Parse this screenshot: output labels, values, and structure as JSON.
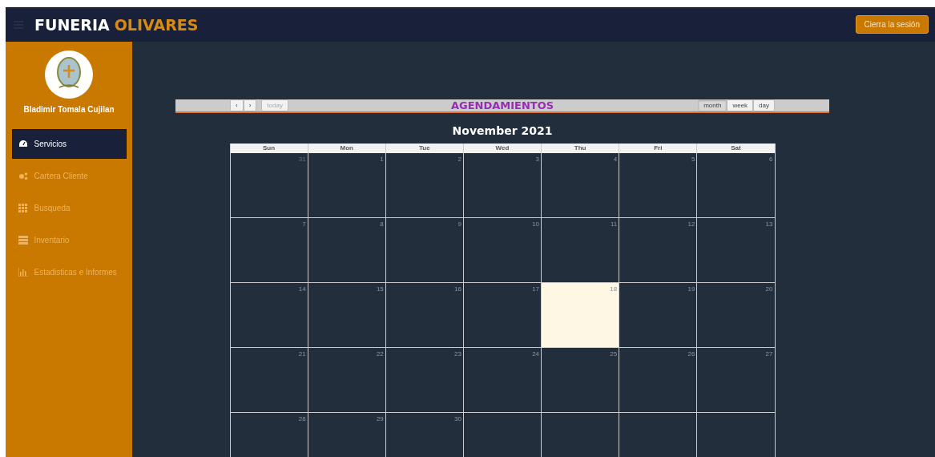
{
  "header": {
    "brand_first": "FUNERIA",
    "brand_second": "OLIVARES",
    "logout_button": "Cierra la sesión"
  },
  "sidebar": {
    "user_name": "Bladimir Tomala Cujilan",
    "items": [
      {
        "label": "Servicios",
        "selected": true
      },
      {
        "label": "Cartera Cliente",
        "selected": false
      },
      {
        "label": "Busqueda",
        "selected": false
      },
      {
        "label": "Inventario",
        "selected": false
      },
      {
        "label": "Estadisticas e Informes",
        "selected": false
      }
    ]
  },
  "calendar": {
    "title": "AGENDAMIENTOS",
    "prev": "‹",
    "next": "›",
    "today_button": "today",
    "views": [
      {
        "label": "month",
        "selected": true
      },
      {
        "label": "week",
        "selected": false
      },
      {
        "label": "day",
        "selected": false
      }
    ],
    "month_title": "November 2021",
    "weekdays": [
      "Sun",
      "Mon",
      "Tue",
      "Wed",
      "Thu",
      "Fri",
      "Sat"
    ],
    "weeks": [
      [
        {
          "day": "31",
          "other_month": true,
          "today": false
        },
        {
          "day": "1",
          "other_month": false,
          "today": false
        },
        {
          "day": "2",
          "other_month": false,
          "today": false
        },
        {
          "day": "3",
          "other_month": false,
          "today": false
        },
        {
          "day": "4",
          "other_month": false,
          "today": false
        },
        {
          "day": "5",
          "other_month": false,
          "today": false
        },
        {
          "day": "6",
          "other_month": false,
          "today": false
        }
      ],
      [
        {
          "day": "7",
          "other_month": false,
          "today": false
        },
        {
          "day": "8",
          "other_month": false,
          "today": false
        },
        {
          "day": "9",
          "other_month": false,
          "today": false
        },
        {
          "day": "10",
          "other_month": false,
          "today": false
        },
        {
          "day": "11",
          "other_month": false,
          "today": false
        },
        {
          "day": "12",
          "other_month": false,
          "today": false
        },
        {
          "day": "13",
          "other_month": false,
          "today": false
        }
      ],
      [
        {
          "day": "14",
          "other_month": false,
          "today": false
        },
        {
          "day": "15",
          "other_month": false,
          "today": false
        },
        {
          "day": "16",
          "other_month": false,
          "today": false
        },
        {
          "day": "17",
          "other_month": false,
          "today": false
        },
        {
          "day": "18",
          "other_month": false,
          "today": true
        },
        {
          "day": "19",
          "other_month": false,
          "today": false
        },
        {
          "day": "20",
          "other_month": false,
          "today": false
        }
      ],
      [
        {
          "day": "21",
          "other_month": false,
          "today": false
        },
        {
          "day": "22",
          "other_month": false,
          "today": false
        },
        {
          "day": "23",
          "other_month": false,
          "today": false
        },
        {
          "day": "24",
          "other_month": false,
          "today": false
        },
        {
          "day": "25",
          "other_month": false,
          "today": false
        },
        {
          "day": "26",
          "other_month": false,
          "today": false
        },
        {
          "day": "27",
          "other_month": false,
          "today": false
        }
      ],
      [
        {
          "day": "28",
          "other_month": false,
          "today": false
        },
        {
          "day": "29",
          "other_month": false,
          "today": false
        },
        {
          "day": "30",
          "other_month": false,
          "today": false
        },
        {
          "today": false
        },
        {
          "today": false
        },
        {
          "today": false
        },
        {
          "today": false
        }
      ]
    ]
  }
}
